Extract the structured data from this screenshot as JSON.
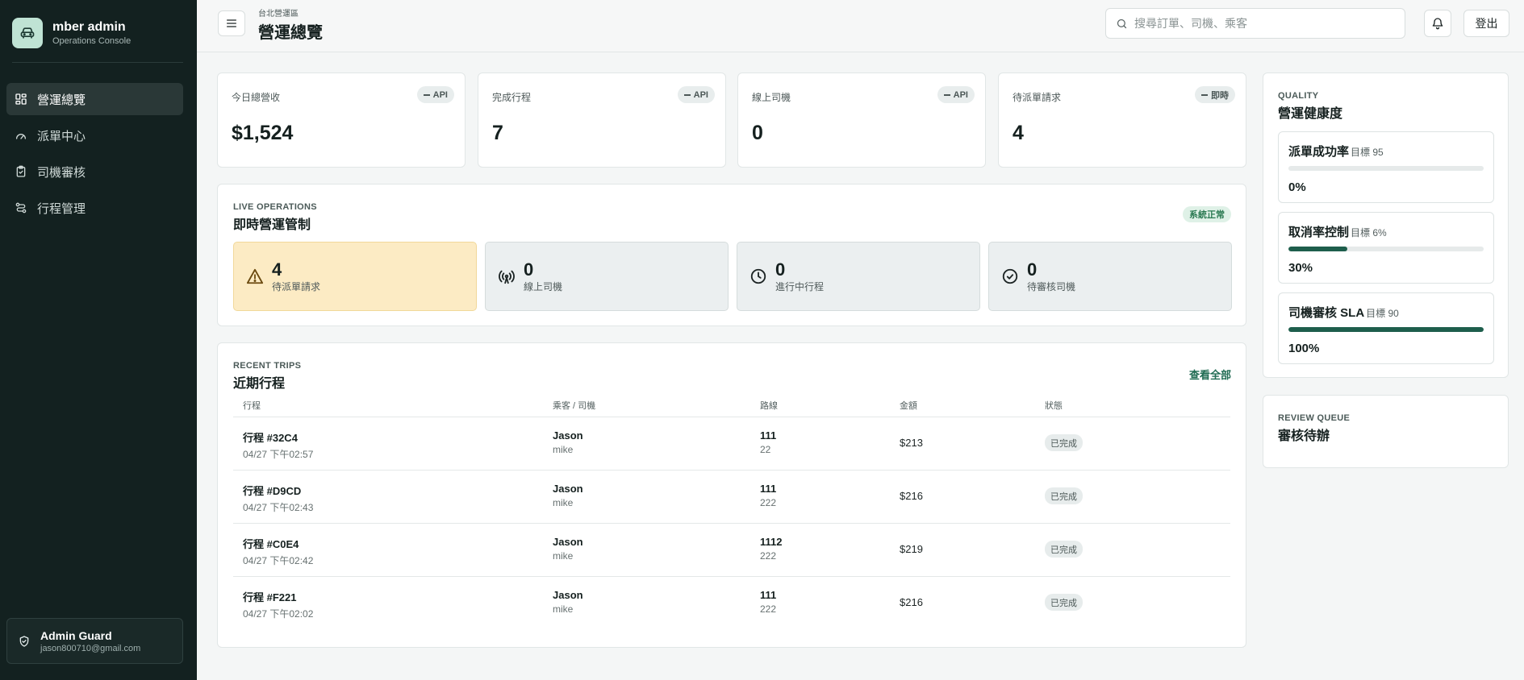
{
  "brand": {
    "name": "mber admin",
    "subtitle": "Operations Console"
  },
  "nav": [
    {
      "label": "營運總覽",
      "icon": "dashboard-icon",
      "active": true
    },
    {
      "label": "派單中心",
      "icon": "gauge-icon",
      "active": false
    },
    {
      "label": "司機審核",
      "icon": "clipboard-check-icon",
      "active": false
    },
    {
      "label": "行程管理",
      "icon": "route-icon",
      "active": false
    }
  ],
  "user": {
    "name": "Admin Guard",
    "email": "jason800710@gmail.com"
  },
  "header": {
    "kicker": "台北營運區",
    "title": "營運總覽",
    "search_placeholder": "搜尋訂單、司機、乘客",
    "logout_label": "登出"
  },
  "stats": [
    {
      "label": "今日總營收",
      "badge": "API",
      "value": "$1,524"
    },
    {
      "label": "完成行程",
      "badge": "API",
      "value": "7"
    },
    {
      "label": "線上司機",
      "badge": "API",
      "value": "0"
    },
    {
      "label": "待派單請求",
      "badge": "即時",
      "value": "4"
    }
  ],
  "live": {
    "kicker": "LIVE OPERATIONS",
    "title": "即時營運管制",
    "badge": "系統正常",
    "boxes": [
      {
        "value": "4",
        "label": "待派單請求",
        "icon": "warning-icon"
      },
      {
        "value": "0",
        "label": "線上司機",
        "icon": "broadcast-icon"
      },
      {
        "value": "0",
        "label": "進行中行程",
        "icon": "clock-icon"
      },
      {
        "value": "0",
        "label": "待審核司機",
        "icon": "check-circle-icon"
      }
    ]
  },
  "trips": {
    "kicker": "RECENT TRIPS",
    "title": "近期行程",
    "view_all": "查看全部",
    "columns": [
      "行程",
      "乘客 / 司機",
      "路線",
      "金額",
      "狀態"
    ],
    "rows": [
      {
        "id": "行程 #32C4",
        "time": "04/27 下午02:57",
        "passenger": "Jason",
        "driver": "mike",
        "from": "111",
        "to": "22",
        "amount": "$213",
        "status": "已完成"
      },
      {
        "id": "行程 #D9CD",
        "time": "04/27 下午02:43",
        "passenger": "Jason",
        "driver": "mike",
        "from": "111",
        "to": "222",
        "amount": "$216",
        "status": "已完成"
      },
      {
        "id": "行程 #C0E4",
        "time": "04/27 下午02:42",
        "passenger": "Jason",
        "driver": "mike",
        "from": "1112",
        "to": "222",
        "amount": "$219",
        "status": "已完成"
      },
      {
        "id": "行程 #F221",
        "time": "04/27 下午02:02",
        "passenger": "Jason",
        "driver": "mike",
        "from": "111",
        "to": "222",
        "amount": "$216",
        "status": "已完成"
      }
    ]
  },
  "quality": {
    "kicker": "QUALITY",
    "title": "營運健康度",
    "items": [
      {
        "name": "派單成功率",
        "target": "目標 95",
        "value": "0%",
        "fill": 0
      },
      {
        "name": "取消率控制",
        "target": "目標 6%",
        "value": "30%",
        "fill": 30
      },
      {
        "name": "司機審核 SLA",
        "target": "目標 90",
        "value": "100%",
        "fill": 100
      }
    ]
  },
  "review": {
    "kicker": "REVIEW QUEUE",
    "title": "審核待辦"
  },
  "colors": {
    "sidebar": "#132120",
    "accent": "#1e5e4c",
    "warn": "#fcebc4",
    "ok": "#2b7a52"
  }
}
